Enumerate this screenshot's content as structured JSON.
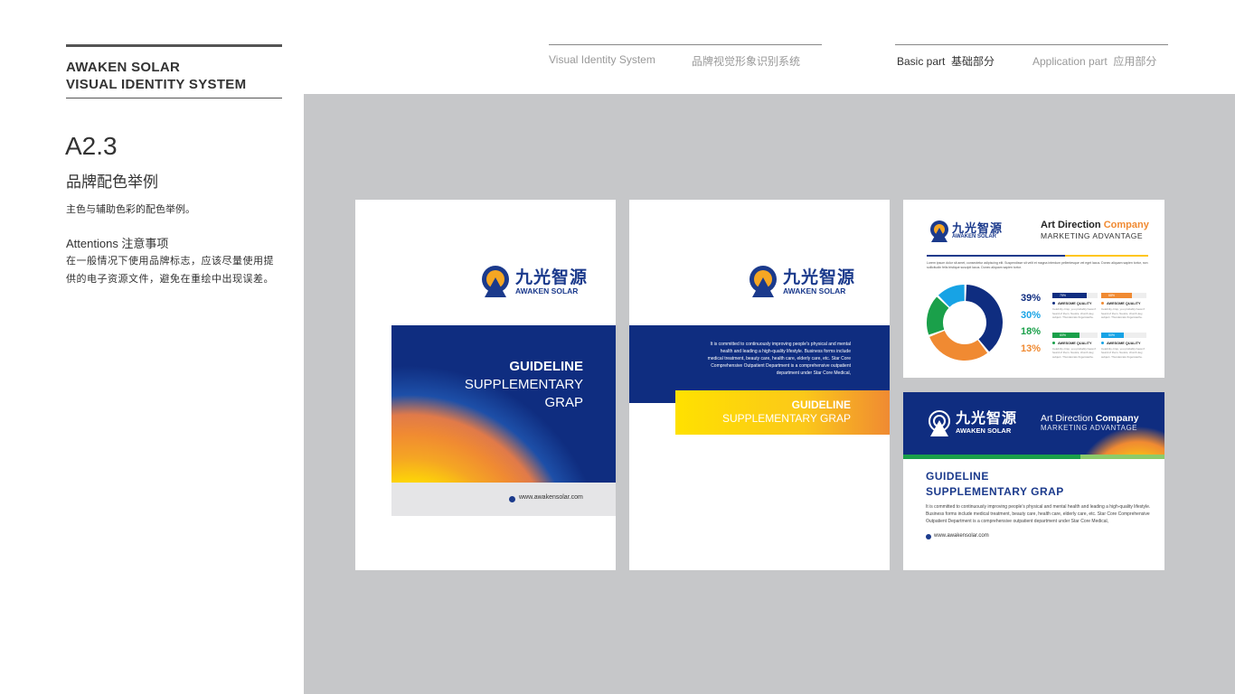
{
  "brand": {
    "line1": "AWAKEN SOLAR",
    "line2": "VISUAL IDENTITY SYSTEM"
  },
  "section": {
    "code": "A2.3",
    "title": "品牌配色举例",
    "desc": "主色与辅助色彩的配色举例。",
    "attention_title": "Attentions 注意事项",
    "attention_text": "在一般情况下使用品牌标志，应该尽量使用提供的电子资源文件，避免在重绘中出现误差。"
  },
  "nav": {
    "vis_en": "Visual Identity System",
    "vis_cn": "品牌视觉形象识别系统",
    "basic": "Basic part  基础部分",
    "application": "Application part  应用部分"
  },
  "logo": {
    "cn": "九光智源",
    "en": "AWAKEN SOLAR"
  },
  "colors": {
    "navy": "#0f2d80",
    "yellow": "#ffe100",
    "orange": "#f08a32",
    "green": "#1aa04a",
    "sky": "#17a3e5",
    "gray_bg": "#c6c7c9"
  },
  "card1": {
    "title1": "GUIDELINE",
    "title2": "SUPPLEMENTARY",
    "title3": "GRAP",
    "url": "www.awakensolar.com"
  },
  "card2": {
    "body": "It is committed to continuously improving people's physical and mental health and leading a high-quality lifestyle. Business forms include medical treatment, beauty care, health care, elderly care, etc. Star Core Comprehensive Outpatient Department is a comprehensive outpatient department under Star Core Medical,",
    "title1": "GUIDELINE",
    "title2": "SUPPLEMENTARY GRAP"
  },
  "card3": {
    "head1a": "Art Direction ",
    "head1b": "Company",
    "head2": "MARKETING ADVANTAGE",
    "lorem": "Lorem ipsum dolor sit amet, consectetur adipiscing elit. Suspendisse sit velit et magna interdum pellentesque vel eget lacus. Donec aliquam sapien tortor, non sollicitudin felis tristique suscipit lacus. Donec aliquam sapien tortor.",
    "chart_data": {
      "type": "pie",
      "values": [
        39,
        30,
        18,
        13
      ],
      "labels": [
        "39%",
        "30%",
        "18%",
        "13%"
      ],
      "colors": [
        "#0f2d80",
        "#f08a32",
        "#1aa04a",
        "#17a3e5"
      ]
    },
    "bars": [
      {
        "label": "75%",
        "value": 75,
        "color": "#0f2d80",
        "name": "AWESOME QUALITY"
      },
      {
        "label": "68%",
        "value": 68,
        "color": "#f08a32",
        "name": "AWESOME QUALITY"
      },
      {
        "label": "60%",
        "value": 60,
        "color": "#1aa04a",
        "name": "AWESOME QUALITY"
      },
      {
        "label": "50%",
        "value": 50,
        "color": "#17a3e5",
        "name": "AWESOME QUALITY"
      }
    ],
    "bar_text": "Celebrity crisp, you probably haven't heard of them. Neutra, church-key, subject. Thundercats fingerstache."
  },
  "card4": {
    "head1a": "Art Direction ",
    "head1b": "Company",
    "head2": "MARKETING ADVANTAGE",
    "title1": "GUIDELINE",
    "title2": "SUPPLEMENTARY GRAP",
    "body": "It is committed to continuously improving people's physical and mental health and leading a high-quality lifestyle. Business forms include medical treatment, beauty care, health care, elderly care, etc. Star Core Comprehensive Outpatient Department is a comprehensive outpatient department under Star Core Medical,",
    "url": "www.awakensolar.com"
  }
}
